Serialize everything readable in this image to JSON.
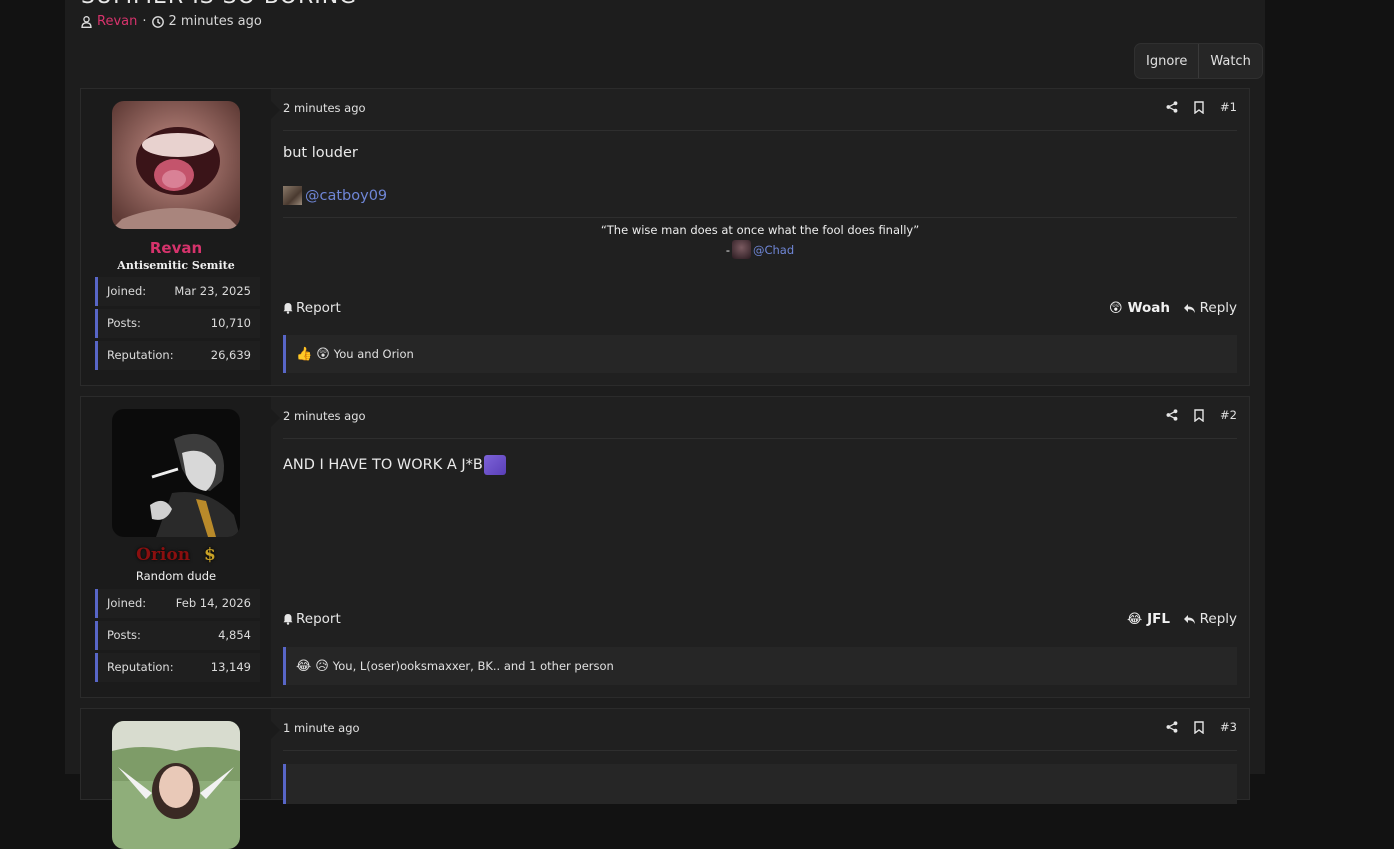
{
  "thread": {
    "title": "SUMMER IS SO BORING",
    "author": "Revan",
    "separator": "·",
    "time": "2 minutes ago",
    "ignore_label": "Ignore",
    "watch_label": "Watch"
  },
  "posts": [
    {
      "username": "Revan",
      "user_title": "Antisemitic Semite",
      "stats": [
        {
          "label": "Joined:",
          "value": "Mar 23, 2025"
        },
        {
          "label": "Posts:",
          "value": "10,710"
        },
        {
          "label": "Reputation:",
          "value": "26,639"
        }
      ],
      "date": "2 minutes ago",
      "number": "#1",
      "body": "but louder",
      "mention": "@catboy09",
      "signature_quote": "“The wise man does at once what the fool does finally”",
      "signature_dash": "-",
      "signature_mention": "@Chad",
      "report_label": "Report",
      "reaction_label": "Woah",
      "reaction_emoji": "😲",
      "reply_label": "Reply",
      "reaction_emojis": [
        "👍",
        "😲"
      ],
      "reaction_users": "You and Orion"
    },
    {
      "username": "Orion",
      "username_badge": "$",
      "user_title": "Random dude",
      "stats": [
        {
          "label": "Joined:",
          "value": "Feb 14, 2026"
        },
        {
          "label": "Posts:",
          "value": "4,854"
        },
        {
          "label": "Reputation:",
          "value": "13,149"
        }
      ],
      "date": "2 minutes ago",
      "number": "#2",
      "body": "AND I HAVE TO WORK A J*B",
      "report_label": "Report",
      "reaction_label": "JFL",
      "reaction_emoji": "😂",
      "reply_label": "Reply",
      "reaction_emojis": [
        "😂",
        "😥"
      ],
      "reaction_users": "You, L(oser)ooksmaxxer, BK.. and 1 other person"
    },
    {
      "date": "1 minute ago",
      "number": "#3"
    }
  ]
}
